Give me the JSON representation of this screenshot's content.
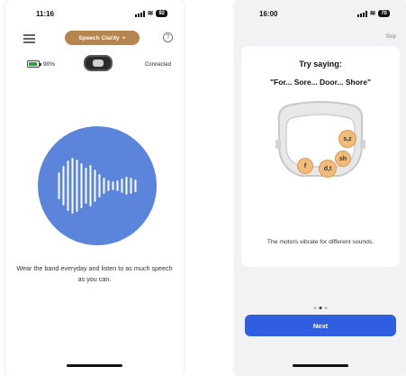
{
  "left": {
    "status": {
      "time": "11:16",
      "battery": "92"
    },
    "header": {
      "mode_label": "Speech Clarity",
      "mode_chevron": "+",
      "help_glyph": "?"
    },
    "device": {
      "battery_percent": "90%",
      "battery_level": 0.9,
      "status": "Connected"
    },
    "description": "Wear the band everyday and listen to as much speech as you can.",
    "colors": {
      "circle": "#5a85db",
      "pill": "#b58550",
      "battery_fill": "#2ea043"
    },
    "icons": [
      "menu-icon",
      "help-icon",
      "battery-icon",
      "band-image",
      "waveform-icon"
    ]
  },
  "right": {
    "status": {
      "time": "16:00",
      "battery": "70"
    },
    "skip_label": "Skip",
    "title": "Try saying:",
    "phrase": "\"For... Sore... Door... Shore\"",
    "sounds": [
      {
        "label": "s,z"
      },
      {
        "label": "sh"
      },
      {
        "label": "f"
      },
      {
        "label": "d,t"
      }
    ],
    "vibrate_text": "The motors vibrate for different sounds.",
    "pager": {
      "count": 3,
      "active": 1
    },
    "next_label": "Next",
    "colors": {
      "next_button": "#2f5ee0",
      "sound_dot": "#f1bc7a"
    }
  }
}
